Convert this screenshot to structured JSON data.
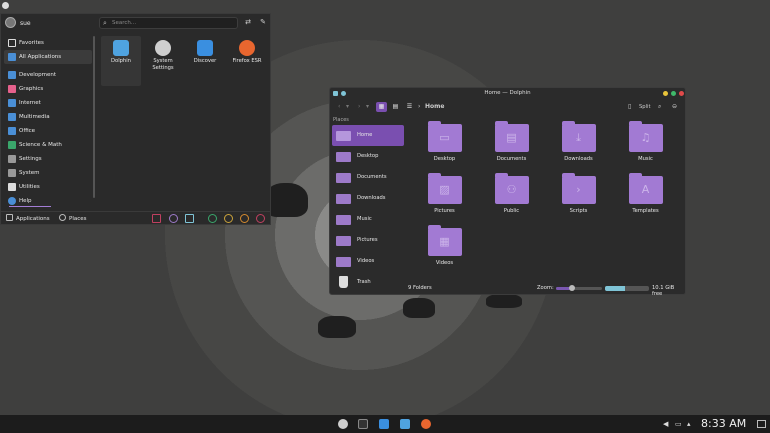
{
  "launcher": {
    "username": "sue",
    "search_placeholder": "Search...",
    "categories": [
      {
        "label": "Favorites",
        "color": "#ffffff"
      },
      {
        "label": "All Applications",
        "color": "#4a8fd6"
      },
      {
        "label": "Development",
        "color": "#4a8fd6"
      },
      {
        "label": "Graphics",
        "color": "#e6618c"
      },
      {
        "label": "Internet",
        "color": "#4a8fd6"
      },
      {
        "label": "Multimedia",
        "color": "#4a8fd6"
      },
      {
        "label": "Office",
        "color": "#4a8fd6"
      },
      {
        "label": "Science & Math",
        "color": "#3aa66b"
      },
      {
        "label": "Settings",
        "color": "#aaaaaa"
      },
      {
        "label": "System",
        "color": "#aaaaaa"
      },
      {
        "label": "Utilities",
        "color": "#dddddd"
      },
      {
        "label": "Help",
        "color": "#4a8fd6"
      }
    ],
    "apps": [
      {
        "label": "Dolphin",
        "color": "#4fa3e0",
        "icon": "folder-icon"
      },
      {
        "label": "System Settings",
        "color": "#bbbbbb",
        "icon": "gear-icon"
      },
      {
        "label": "Discover",
        "color": "#3a8fe0",
        "icon": "store-icon"
      },
      {
        "label": "Firefox ESR",
        "color": "#e8662f",
        "icon": "firefox-icon"
      }
    ],
    "bottom_applications": "Applications",
    "bottom_places": "Places"
  },
  "dolphin": {
    "title": "Home — Dolphin",
    "breadcrumb": "Home",
    "split_label": "Split",
    "places_header": "Places",
    "places": [
      "Home",
      "Desktop",
      "Documents",
      "Downloads",
      "Music",
      "Pictures",
      "Videos",
      "Trash"
    ],
    "folders": [
      {
        "label": "Desktop",
        "glyph": "▭"
      },
      {
        "label": "Documents",
        "glyph": "▤"
      },
      {
        "label": "Downloads",
        "glyph": "⤓"
      },
      {
        "label": "Music",
        "glyph": "♫"
      },
      {
        "label": "Pictures",
        "glyph": "▨"
      },
      {
        "label": "Public",
        "glyph": "⚇"
      },
      {
        "label": "Scripts",
        "glyph": "›"
      },
      {
        "label": "Templates",
        "glyph": "A"
      },
      {
        "label": "Videos",
        "glyph": "▦"
      }
    ],
    "status_count": "9 Folders",
    "zoom_label": "Zoom:",
    "zoom_level": 0.35,
    "used_fraction": 0.45,
    "free_space": "10.1 GiB free"
  },
  "taskbar": {
    "clock": "8:33 AM"
  }
}
